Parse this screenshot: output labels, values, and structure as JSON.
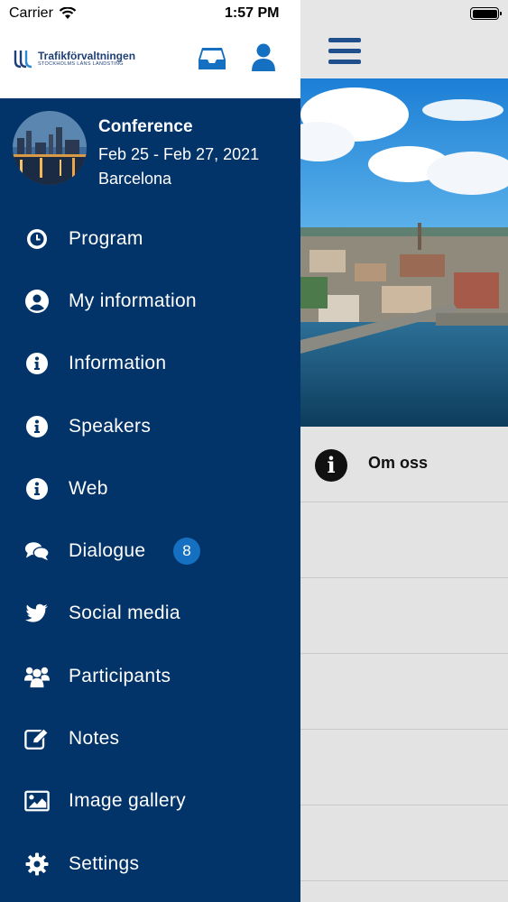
{
  "status_bar": {
    "carrier": "Carrier",
    "time": "1:57 PM"
  },
  "header": {
    "logo_brand": "Trafikförvaltningen",
    "logo_sub": "STOCKHOLMS LÄNS LANDSTING"
  },
  "conference": {
    "title": "Conference",
    "dates": "Feb 25 - Feb 27, 2021",
    "location": "Barcelona"
  },
  "menu": {
    "items": [
      {
        "label": "Program",
        "icon": "clock-icon"
      },
      {
        "label": "My information",
        "icon": "user-circle-icon"
      },
      {
        "label": "Information",
        "icon": "info-icon"
      },
      {
        "label": "Speakers",
        "icon": "info-icon"
      },
      {
        "label": "Web",
        "icon": "info-icon"
      },
      {
        "label": "Dialogue",
        "icon": "chat-icon",
        "badge": "8"
      },
      {
        "label": "Social media",
        "icon": "twitter-icon"
      },
      {
        "label": "Participants",
        "icon": "users-icon"
      },
      {
        "label": "Notes",
        "icon": "edit-icon"
      },
      {
        "label": "Image gallery",
        "icon": "image-icon"
      },
      {
        "label": "Settings",
        "icon": "gear-icon"
      }
    ]
  },
  "main": {
    "rows": [
      {
        "label": "Om oss",
        "icon": "info-icon"
      }
    ]
  },
  "colors": {
    "drawer_bg": "#023369",
    "accent": "#1f4f8c",
    "badge": "#1570c2"
  }
}
